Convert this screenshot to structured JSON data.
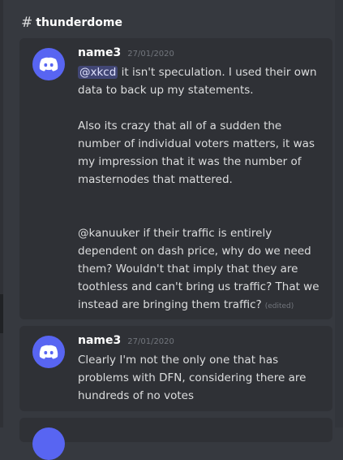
{
  "channel": {
    "hash": "#",
    "name": "thunderdome"
  },
  "messages": [
    {
      "author": "name3",
      "time": "27/01/2020",
      "mention": "@xkcd",
      "p1_rest": " it isn't speculation. I used their own data to back up my statements.",
      "p2": "Also its crazy that all of a sudden the number of individual voters matters, it was my impression that it was the number of masternodes that mattered.",
      "p3": "@kanuuker if their traffic is entirely dependent on dash price, why do we need them? Wouldn't that imply that they are toothless and can't bring us traffic? That we instead are bringing them traffic?",
      "edited": "(edited)"
    },
    {
      "author": "name3",
      "time": "27/01/2020",
      "text": "Clearly I'm not the only one that has problems with DFN, considering there are hundreds of no votes"
    }
  ],
  "colors": {
    "background": "#36393f",
    "card": "#2f3136",
    "avatar": "#5865f2",
    "mention_bg": "#414675"
  },
  "icons": {
    "avatar": "discord-logo-icon"
  }
}
